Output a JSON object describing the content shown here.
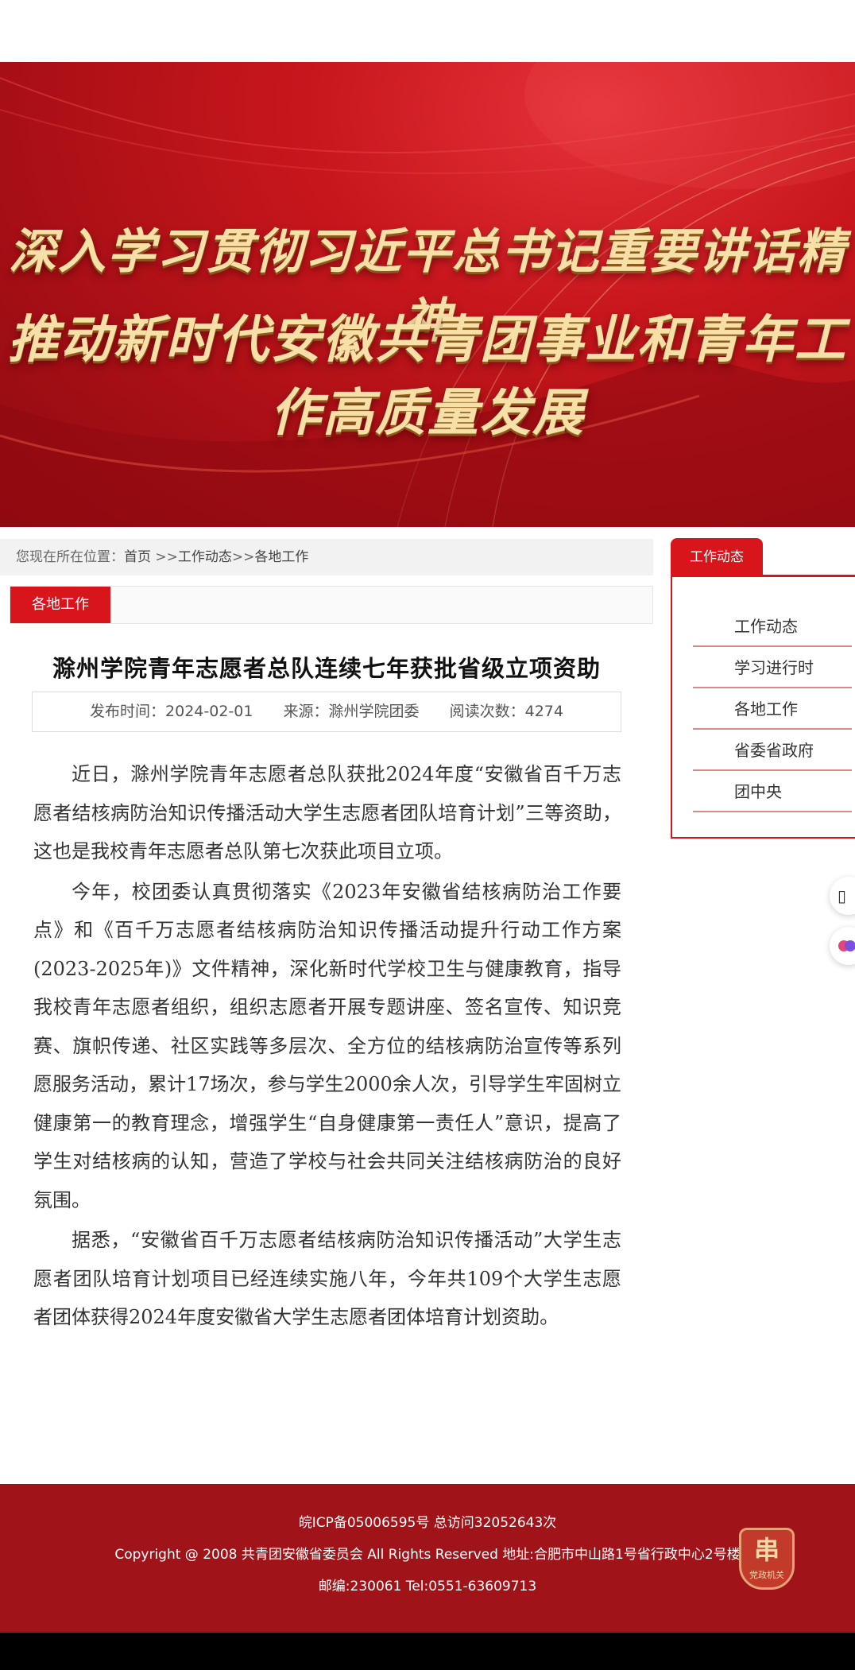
{
  "banner": {
    "line1": "深入学习贯彻习近平总书记重要讲话精神",
    "line2": "推动新时代安徽共青团事业和青年工作高质量发展"
  },
  "breadcrumb": {
    "prefix": "您现在所在位置：",
    "home": "首页",
    "sep1": " >>",
    "section": "工作动态",
    "sep2": ">>",
    "current": "各地工作"
  },
  "section_tag": "各地工作",
  "article": {
    "title": "滁州学院青年志愿者总队连续七年获批省级立项资助",
    "publish_label": "发布时间：",
    "publish_date": "2024-02-01",
    "source_label": "来源：",
    "source": "滁州学院团委",
    "reads_label": "阅读次数：",
    "reads": "4274",
    "paragraphs": [
      "近日，滁州学院青年志愿者总队获批2024年度“安徽省百千万志愿者结核病防治知识传播活动大学生志愿者团队培育计划”三等资助，这也是我校青年志愿者总队第七次获此项目立项。",
      "今年，校团委认真贯彻落实《2023年安徽省结核病防治工作要点》和《百千万志愿者结核病防治知识传播活动提升行动工作方案(2023-2025年)》文件精神，深化新时代学校卫生与健康教育，指导我校青年志愿者组织，组织志愿者开展专题讲座、签名宣传、知识竞赛、旗帜传递、社区实践等多层次、全方位的结核病防治宣传等系列愿服务活动，累计17场次，参与学生2000余人次，引导学生牢固树立健康第一的教育理念，增强学生“自身健康第一责任人”意识，提高了学生对结核病的认知，营造了学校与社会共同关注结核病防治的良好氛围。",
      "据悉，“安徽省百千万志愿者结核病防治知识传播活动”大学生志愿者团队培育计划项目已经连续实施八年，今年共109个大学生志愿者团体获得2024年度安徽省大学生志愿者团体培育计划资助。"
    ]
  },
  "sidebar": {
    "tab": "工作动态",
    "items": [
      {
        "label": "工作动态"
      },
      {
        "label": "学习进行时"
      },
      {
        "label": "各地工作"
      },
      {
        "label": "省委省政府"
      },
      {
        "label": "团中央"
      }
    ]
  },
  "footer": {
    "line1": "皖ICP备05006595号 总访问32052643次",
    "line2": "Copyright @ 2008 共青团安徽省委员会 All Rights Reserved 地址:合肥市中山路1号省行政中心2号楼",
    "line3": "邮编:230061 Tel:0551-63609713",
    "emblem_text": "党政机关"
  },
  "colors": {
    "brand_red": "#d7151b",
    "footer_red": "#a01419"
  }
}
